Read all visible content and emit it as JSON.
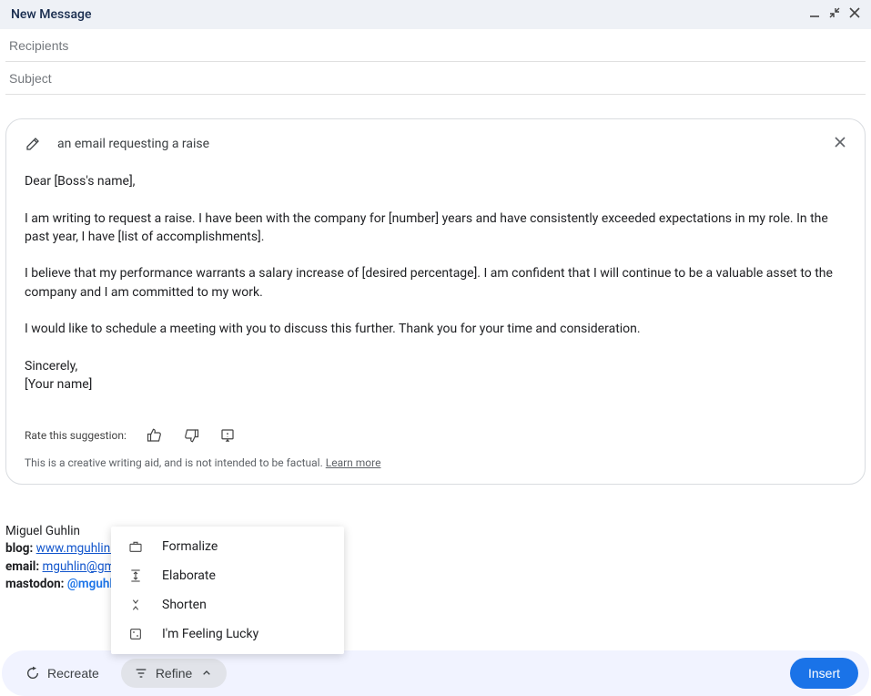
{
  "titlebar": {
    "title": "New Message"
  },
  "fields": {
    "recipients_placeholder": "Recipients",
    "subject_placeholder": "Subject"
  },
  "suggestion": {
    "prompt": "an email requesting a raise",
    "body": "Dear [Boss's name],\n\nI am writing to request a raise. I have been with the company for [number] years and have consistently exceeded expectations in my role. In the past year, I have [list of accomplishments].\n\nI believe that my performance warrants a salary increase of [desired percentage]. I am confident that I will continue to be a valuable asset to the company and I am committed to my work.\n\nI would like to schedule a meeting with you to discuss this further. Thank you for your time and consideration.\n\nSincerely,\n[Your name]",
    "rate_label": "Rate this suggestion:",
    "disclaimer_text": "This is a creative writing aid, and is not intended to be factual. ",
    "learn_more": "Learn more"
  },
  "signature": {
    "name": "Miguel Guhlin",
    "blog_label": "blog:",
    "blog_link": "www.mguhlin.o",
    "email_label": "email:",
    "email_link": "mguhlin@gm",
    "mastodon_label": "mastodon:",
    "mastodon_handle": "@mguhl"
  },
  "refine_menu": {
    "items": [
      {
        "label": "Formalize",
        "icon": "briefcase-icon"
      },
      {
        "label": "Elaborate",
        "icon": "expand-vertical-icon"
      },
      {
        "label": "Shorten",
        "icon": "collapse-vertical-icon"
      },
      {
        "label": "I'm Feeling Lucky",
        "icon": "dice-icon"
      }
    ]
  },
  "bottom_bar": {
    "recreate_label": "Recreate",
    "refine_label": "Refine",
    "insert_label": "Insert"
  }
}
